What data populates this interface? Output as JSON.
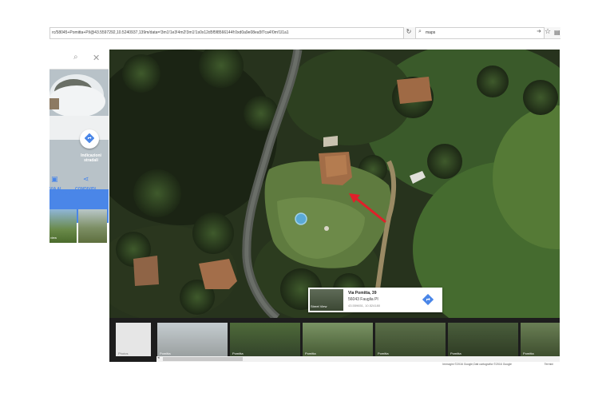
{
  "browser": {
    "url": "rc/58045+Pomitta+Pl/@43.5597292,10.5240937,139m/data=!3m1!1e3!4m2!3m1!1s0x12d5f5f8566144f:0xd0a9e08ea5f7ca4!0m!1l1a1",
    "search_placeholder": "maps",
    "reload_icon": "reload-icon",
    "star_icon": "star-icon"
  },
  "panel": {
    "directions_label": "Indicazioni stradali",
    "actions": [
      {
        "label": "VIA AL TELEFONO",
        "icon": "phone-icon"
      },
      {
        "label": "CONDIVIDI",
        "icon": "share-icon"
      }
    ],
    "thumb_label": "view"
  },
  "info_card": {
    "street_view_label": "Street View",
    "address": "Via Pomitta, 39",
    "city": "56043 Fauglia PI",
    "coords": "43.559651, 10.524180"
  },
  "filmstrip": {
    "tiles": [
      {
        "label": "Photos"
      },
      {
        "label": "Pomitta"
      },
      {
        "label": "Pomitta"
      },
      {
        "label": "Pomitta"
      },
      {
        "label": "Pomitta"
      },
      {
        "label": "Pomitta"
      },
      {
        "label": "Pomitta"
      }
    ]
  },
  "footer": {
    "attribution": "Immagini ©2016 Google,Dati cartografici ©2016 Google",
    "terms": "Termini"
  },
  "colors": {
    "accent_blue": "#4a86e8",
    "marker_red": "#e0202a"
  }
}
